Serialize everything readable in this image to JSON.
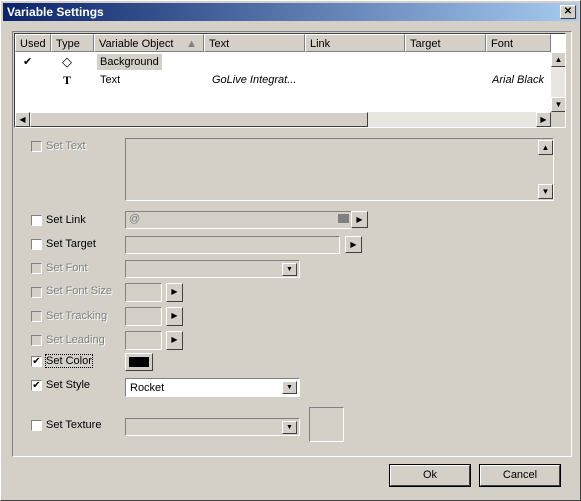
{
  "window": {
    "title": "Variable Settings",
    "close_glyph": "✕"
  },
  "list": {
    "columns": [
      "Used",
      "Type",
      "Variable Object",
      "Text",
      "Link",
      "Target",
      "Font"
    ],
    "rows": [
      {
        "used": "✔",
        "type": "◇",
        "object": "Background",
        "text": "",
        "font": ""
      },
      {
        "used": "",
        "type": "T",
        "object": "Text",
        "text": "GoLive Integrat...",
        "font": "Arial Black"
      }
    ]
  },
  "fields": {
    "set_text": "Set Text",
    "set_link": "Set Link",
    "set_target": "Set Target",
    "set_font": "Set Font",
    "set_font_size": "Set Font Size",
    "set_tracking": "Set Tracking",
    "set_leading": "Set Leading",
    "set_color": "Set Color",
    "set_style": "Set Style",
    "set_texture": "Set Texture",
    "link_prefix": "@",
    "style_value": "Rocket",
    "check_mark": "✔",
    "color_value": "#000000"
  },
  "buttons": {
    "ok": "Ok",
    "cancel": "Cancel"
  }
}
